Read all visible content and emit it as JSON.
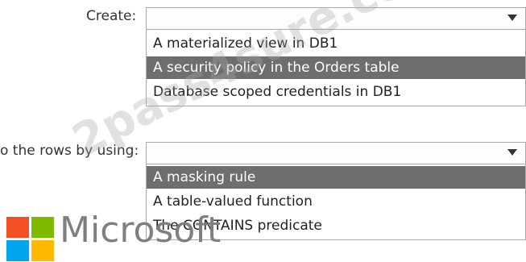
{
  "create": {
    "label": "Create:",
    "value": "",
    "options": [
      "A materialized view in DB1",
      "A security policy in the Orders table",
      "Database scoped credentials in DB1"
    ],
    "selected_index": 1
  },
  "rows": {
    "label": "o the rows by using:",
    "value": "",
    "options": [
      "A masking rule",
      "A table-valued function",
      "The CONTAINS predicate"
    ],
    "selected_index": 0
  },
  "watermark": "2pass4sure.com",
  "brand": {
    "name": "Microsoft",
    "colors": {
      "red": "#f25022",
      "green": "#7fba00",
      "blue": "#00a4ef",
      "yellow": "#ffb900"
    }
  },
  "icons": {
    "dropdown": "chevron-down-icon",
    "logo": "microsoft-logo-icon"
  }
}
